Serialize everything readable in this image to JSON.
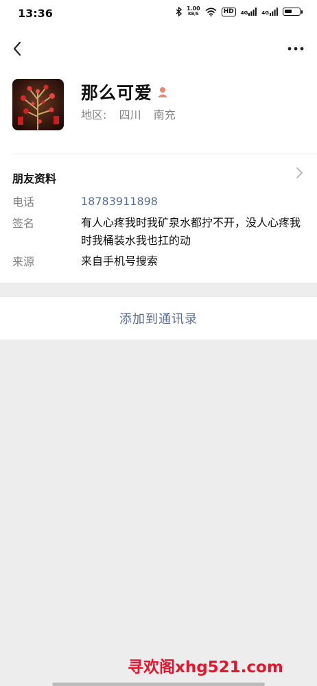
{
  "status_bar": {
    "time": "13:36",
    "net_speed_value": "1.00",
    "net_speed_unit": "KB/S",
    "hd_badge": "HD",
    "signal1_label": "4G",
    "signal2_label": "4G",
    "battery_percent": 50
  },
  "header": {
    "back_icon": "chevron-left-icon",
    "more_icon": "more-dots-icon"
  },
  "profile": {
    "name": "那么可爱",
    "gender_icon": "person-icon",
    "region_label": "地区:",
    "region_province": "四川",
    "region_city": "南充"
  },
  "section": {
    "title": "朋友资料"
  },
  "info": {
    "phone_label": "电话",
    "phone_value": "18783911898",
    "signature_label": "签名",
    "signature_value": "有人心疼我时我矿泉水都拧不开，没人心疼我时我桶装水我也扛的动",
    "source_label": "来源",
    "source_value": "来自手机号搜索"
  },
  "actions": {
    "add_contact": "添加到通讯录"
  },
  "watermark": "寻欢阁xhg521.com",
  "colors": {
    "link": "#576b95",
    "gray_text": "#808080",
    "background": "#ededed",
    "watermark": "#e8142c"
  }
}
